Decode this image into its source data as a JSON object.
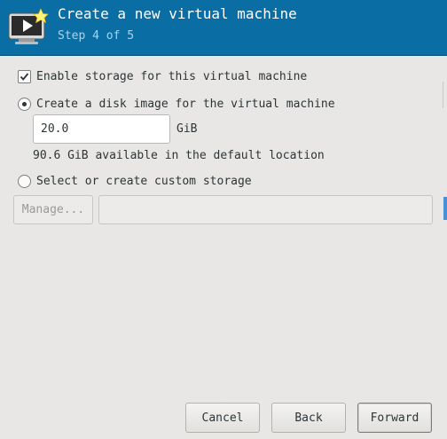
{
  "header": {
    "title": "Create a new virtual machine",
    "subtitle": "Step 4 of 5",
    "icon": "vm-monitor-star-icon",
    "background": "#0a6ea5"
  },
  "storage": {
    "enable_label": "Enable storage for this virtual machine",
    "enable_checked": true,
    "create_disk_label": "Create a disk image for the virtual machine",
    "create_disk_selected": true,
    "disk_size_value": "20.0",
    "disk_size_unit": "GiB",
    "decrement_symbol": "−",
    "increment_symbol": "+",
    "available_text": "90.6 GiB available in the default location",
    "custom_label": "Select or create custom storage",
    "custom_selected": false,
    "manage_label": "Manage...",
    "custom_path_value": ""
  },
  "footer": {
    "cancel_label": "Cancel",
    "back_label": "Back",
    "forward_label": "Forward"
  }
}
